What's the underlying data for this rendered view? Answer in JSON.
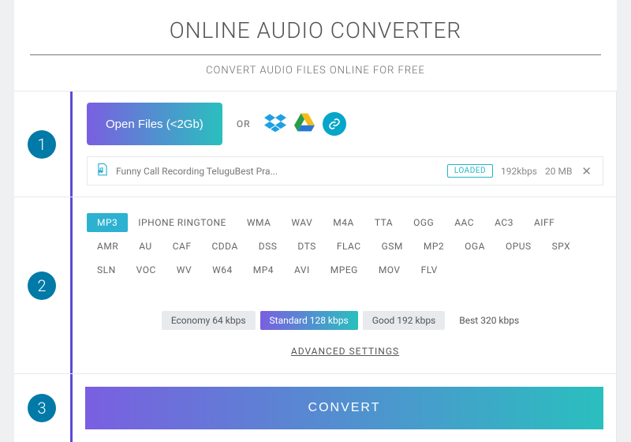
{
  "title": "ONLINE AUDIO CONVERTER",
  "subtitle": "CONVERT AUDIO FILES ONLINE FOR FREE",
  "steps": {
    "one": "1",
    "two": "2",
    "three": "3"
  },
  "upload": {
    "open_label": "Open Files (<2Gb)",
    "or": "OR",
    "file": {
      "name": "Funny Call Recording TeluguBest Pra...",
      "status": "LOADED",
      "bitrate": "192kbps",
      "size": "20 MB"
    }
  },
  "formats": [
    "MP3",
    "IPHONE RINGTONE",
    "WMA",
    "WAV",
    "M4A",
    "TTA",
    "OGG",
    "AAC",
    "AC3",
    "AIFF",
    "AMR",
    "AU",
    "CAF",
    "CDDA",
    "DSS",
    "DTS",
    "FLAC",
    "GSM",
    "MP2",
    "OGA",
    "OPUS",
    "SPX",
    "SLN",
    "VOC",
    "WV",
    "W64",
    "MP4",
    "AVI",
    "MPEG",
    "MOV",
    "FLV"
  ],
  "active_format": "MP3",
  "qualities": [
    "Economy 64 kbps",
    "Standard 128 kbps",
    "Good 192 kbps",
    "Best 320 kbps"
  ],
  "active_quality": "Standard 128 kbps",
  "advanced": "ADVANCED SETTINGS",
  "convert": "CONVERT"
}
